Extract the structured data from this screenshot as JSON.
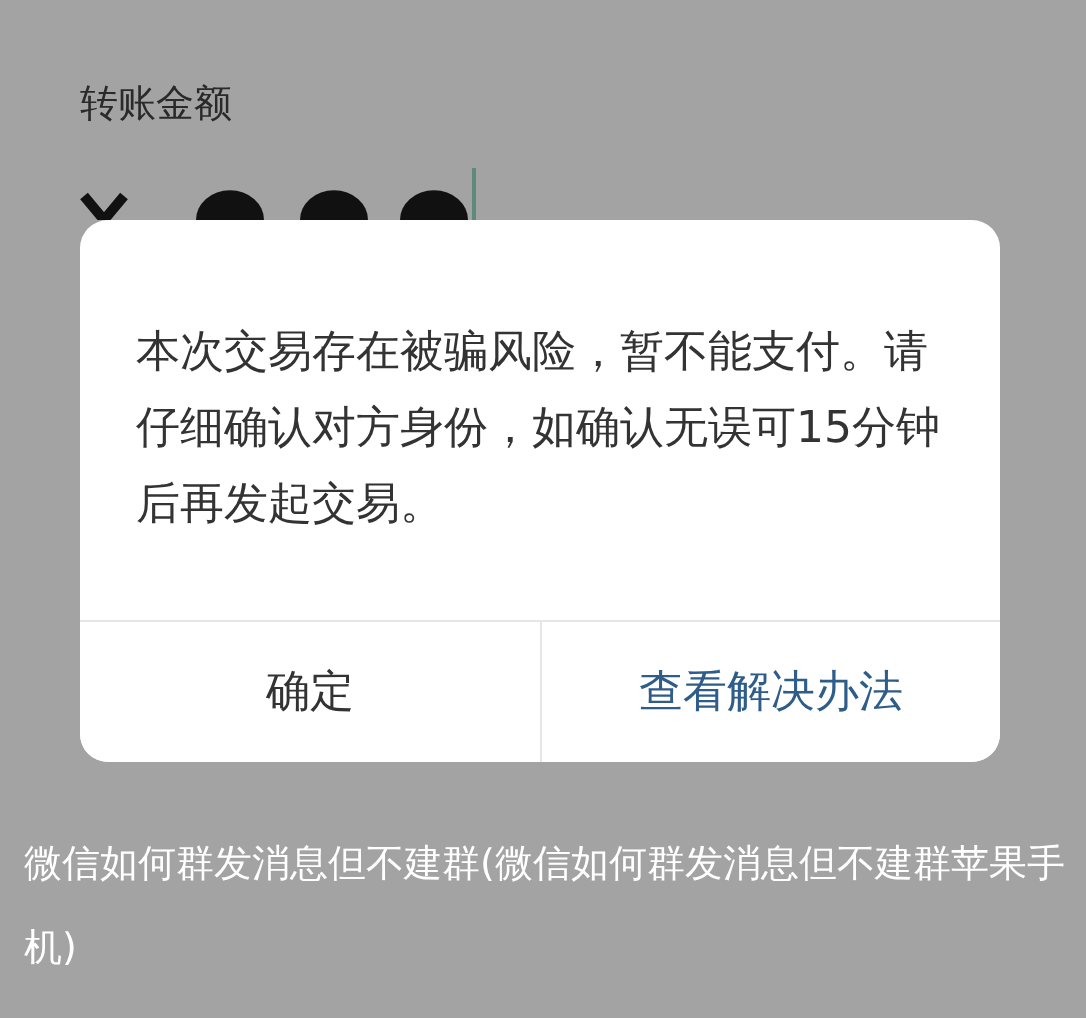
{
  "page": {
    "label": "转账金额"
  },
  "dialog": {
    "message": "本次交易存在被骗风险，暂不能支付。请仔细确认对方身份，如确认无误可15分钟后再发起交易。",
    "buttons": [
      {
        "label": "确定",
        "kind": "cancel"
      },
      {
        "label": "查看解决办法",
        "kind": "primary"
      }
    ]
  },
  "caption": "微信如何群发消息但不建群(微信如何群发消息但不建群苹果手机)"
}
